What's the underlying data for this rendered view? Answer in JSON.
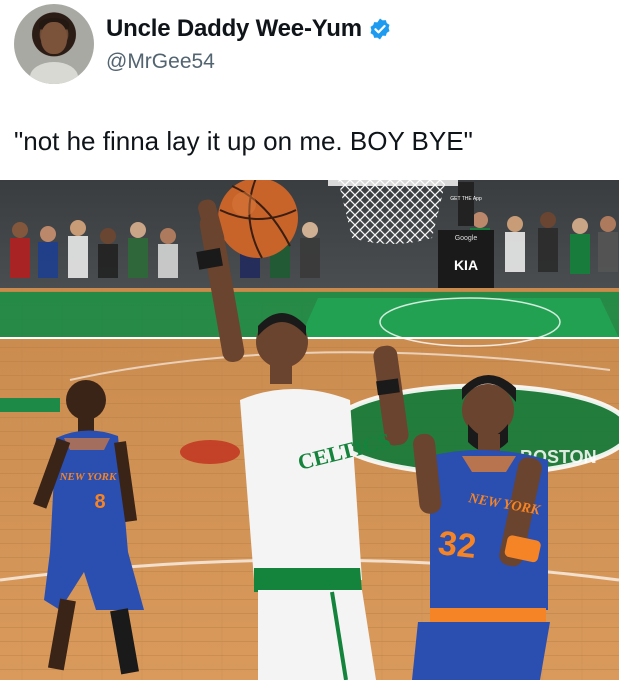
{
  "tweet": {
    "author": {
      "display_name": "Uncle Daddy Wee-Yum",
      "handle": "@MrGee54",
      "verified": true,
      "avatar_icon": "child-portrait-avatar"
    },
    "text": "\"not he finna lay it up on me. BOY BYE\"",
    "media": {
      "icon": "basketball-photo",
      "jersey_left": "NEW YORK",
      "number_left": "8",
      "jersey_center": "CELTICS",
      "jersey_right": "NEW YORK",
      "number_right": "32",
      "sign_brand": "KIA",
      "sign_top": "Google",
      "sign_get": "GET THE App",
      "court_text": "BOSTON"
    }
  },
  "colors": {
    "verified": "#1d9bf0",
    "handle": "#536471",
    "knicks_blue": "#2a4fb0",
    "knicks_orange": "#f58426",
    "celtics_green": "#14833b"
  }
}
